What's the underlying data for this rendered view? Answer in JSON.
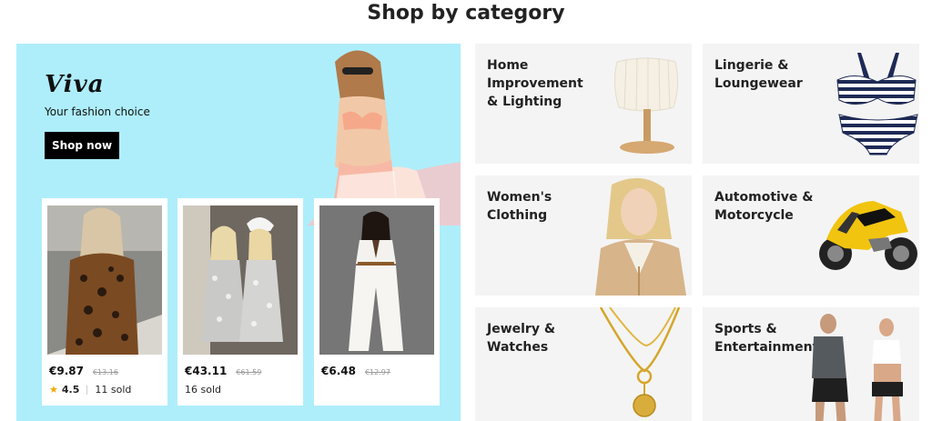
{
  "page": {
    "title": "Shop by category"
  },
  "promo": {
    "brand": "Viva",
    "tagline": "Your fashion choice",
    "cta_label": "Shop now",
    "background": "#aeeefb",
    "products": [
      {
        "price": "€9.87",
        "old_price": "€13.16",
        "rating": "4.5",
        "sold": "11 sold"
      },
      {
        "price": "€43.11",
        "old_price": "€61.59",
        "sold": "16 sold"
      },
      {
        "price": "€6.48",
        "old_price": "€12.97"
      }
    ]
  },
  "categories": [
    {
      "label": "Home Improvement & Lighting",
      "icon": "table-lamp-image"
    },
    {
      "label": "Lingerie & Loungewear",
      "icon": "striped-bikini-image"
    },
    {
      "label": "Women's Clothing",
      "icon": "woman-in-trench-coat-image"
    },
    {
      "label": "Automotive & Motorcycle",
      "icon": "yellow-motorcycle-image"
    },
    {
      "label": "Jewelry & Watches",
      "icon": "gold-necklace-image"
    },
    {
      "label": "Sports & Entertainment",
      "icon": "runners-image"
    }
  ]
}
